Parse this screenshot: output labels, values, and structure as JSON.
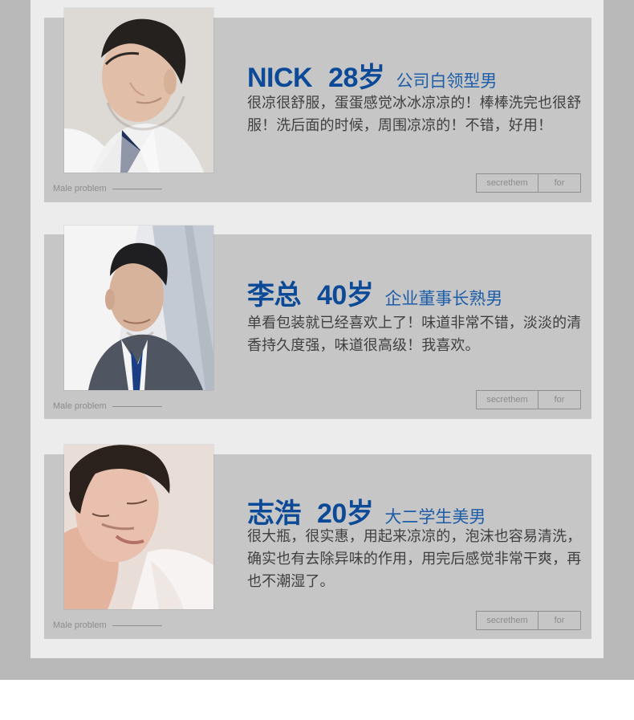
{
  "section": {
    "background_color": "#b9b9b9",
    "panel_color": "#ececec",
    "card_color": "#c6c6c6",
    "accent_blue": "#0c4a97"
  },
  "reviews": [
    {
      "name": "NICK",
      "age": "28岁",
      "type": "公司白领型男",
      "text": "很凉很舒服，蛋蛋感觉冰冰凉凉的！棒棒洗完也很舒服！洗后面的时候，周围凉凉的！不错，好用！",
      "male_label": "Male problem",
      "tag_left": "secrethem",
      "tag_right": "for"
    },
    {
      "name": "李总",
      "age": "40岁",
      "type": "企业董事长熟男",
      "text": "单看包装就已经喜欢上了！味道非常不错，淡淡的清香持久度强，味道很高级！我喜欢。",
      "male_label": "Male problem",
      "tag_left": "secrethem",
      "tag_right": "for"
    },
    {
      "name": "志浩",
      "age": "20岁",
      "type": "大二学生美男",
      "text": "很大瓶，很实惠，用起来凉凉的，泡沫也容易清洗，确实也有去除异味的作用，用完后感觉非常干爽，再也不潮湿了。",
      "male_label": "Male problem",
      "tag_left": "secrethem",
      "tag_right": "for"
    }
  ]
}
